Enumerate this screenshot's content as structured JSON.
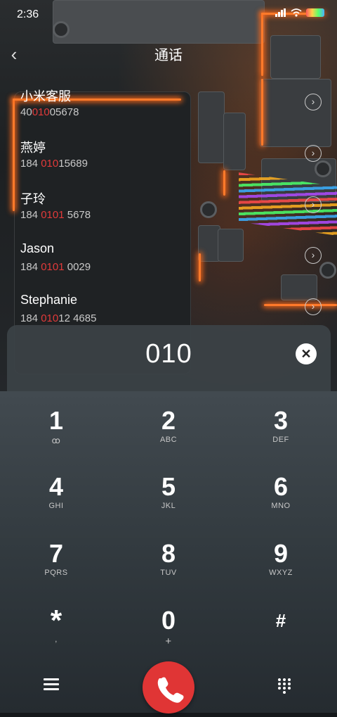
{
  "status_bar": {
    "time": "2:36",
    "signal": "all",
    "wifi": "wifi"
  },
  "header": {
    "title": "通话",
    "back_icon": "‹"
  },
  "contacts": [
    {
      "name": "小米客服",
      "number_pre": "40",
      "number_match": "010",
      "number_post": "05678"
    },
    {
      "name": "燕婷",
      "number_pre": "184 ",
      "number_match": "010",
      "number_post": "15689"
    },
    {
      "name": "子玲",
      "number_pre": "184 ",
      "number_match": "0101",
      "number_post": " 5678"
    },
    {
      "name": "Jason",
      "number_pre": "184 ",
      "number_match": "0101",
      "number_post": " 0029"
    },
    {
      "name": "Stephanie",
      "number_pre": "184 ",
      "number_match": "010",
      "number_post": "12 4685"
    }
  ],
  "dial": {
    "digits": "010",
    "clear_icon": "✕"
  },
  "keypad": [
    {
      "digit": "1",
      "letters": "ꝏ"
    },
    {
      "digit": "2",
      "letters": "ABC"
    },
    {
      "digit": "3",
      "letters": "DEF"
    },
    {
      "digit": "4",
      "letters": "GHI"
    },
    {
      "digit": "5",
      "letters": "JKL"
    },
    {
      "digit": "6",
      "letters": "MNO"
    },
    {
      "digit": "7",
      "letters": "PQRS"
    },
    {
      "digit": "8",
      "letters": "TUV"
    },
    {
      "digit": "9",
      "letters": "WXYZ"
    },
    {
      "digit": "*",
      "letters": ","
    },
    {
      "digit": "0",
      "letters": "+"
    },
    {
      "digit": "#",
      "letters": ""
    }
  ],
  "colors": {
    "accent_red": "#e23a3a",
    "call_button": "#e03535"
  },
  "icons": {
    "back": "chevron-left-icon",
    "info": "info-circle-icon",
    "menu": "menu-icon",
    "call": "phone-icon",
    "dialpad": "dialpad-icon",
    "clear": "close-icon"
  }
}
